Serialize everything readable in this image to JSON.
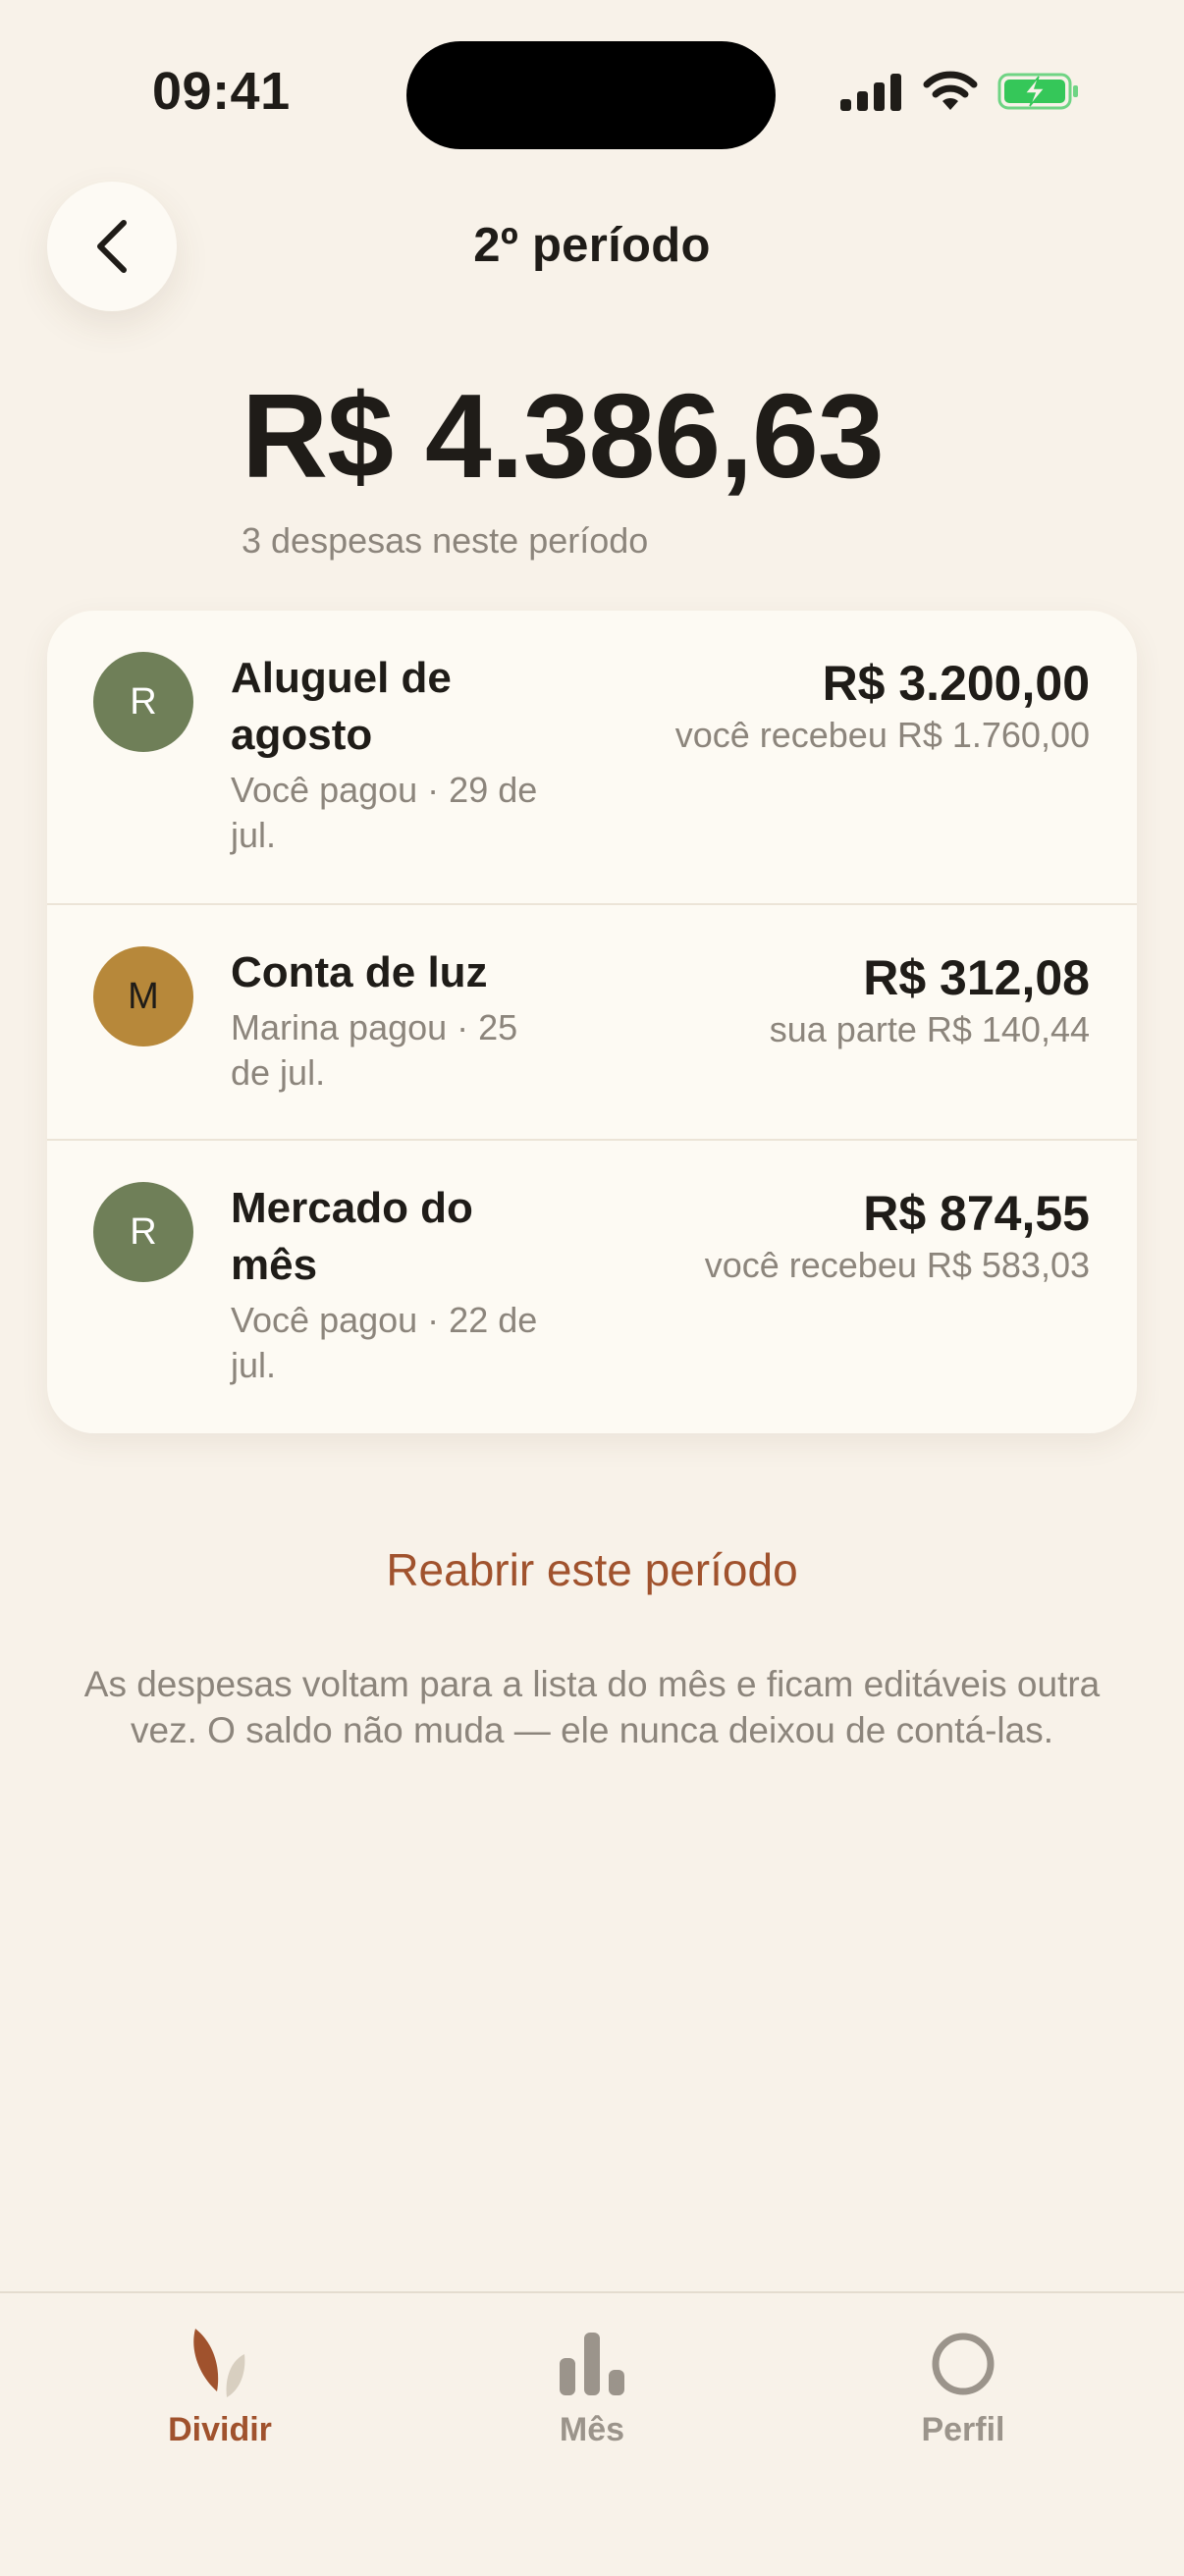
{
  "status": {
    "time": "09:41"
  },
  "header": {
    "title": "2º período"
  },
  "summary": {
    "total": "R$ 4.386,63",
    "subtitle": "3 despesas neste período"
  },
  "expenses": [
    {
      "avatar": "R",
      "avatar_color": "#6f7f58",
      "title": "Aluguel de agosto",
      "meta": "Você pagou · 29 de jul.",
      "amount": "R$ 3.200,00",
      "note": "você recebeu R$ 1.760,00"
    },
    {
      "avatar": "M",
      "avatar_color": "#b7883a",
      "title": "Conta de luz",
      "meta": "Marina pagou · 25 de jul.",
      "amount": "R$ 312,08",
      "note": "sua parte R$ 140,44"
    },
    {
      "avatar": "R",
      "avatar_color": "#6f7f58",
      "title": "Mercado do mês",
      "meta": "Você pagou · 22 de jul.",
      "amount": "R$ 874,55",
      "note": "você recebeu R$ 583,03"
    }
  ],
  "reopen": {
    "link": "Reabrir este período",
    "description": "As despesas voltam para a lista do mês e ficam editáveis outra vez. O saldo não muda — ele nunca deixou de contá-las."
  },
  "tabbar": {
    "items": [
      {
        "label": "Dividir",
        "icon": "leaf-icon",
        "active": true
      },
      {
        "label": "Mês",
        "icon": "bar-chart-icon",
        "active": false
      },
      {
        "label": "Perfil",
        "icon": "profile-circle-icon",
        "active": false
      }
    ]
  },
  "colors": {
    "background": "#f8f2e9",
    "accent": "#a0522d",
    "muted": "#8c857c",
    "inactive_tab": "#9b948b",
    "battery": "#35c759"
  }
}
